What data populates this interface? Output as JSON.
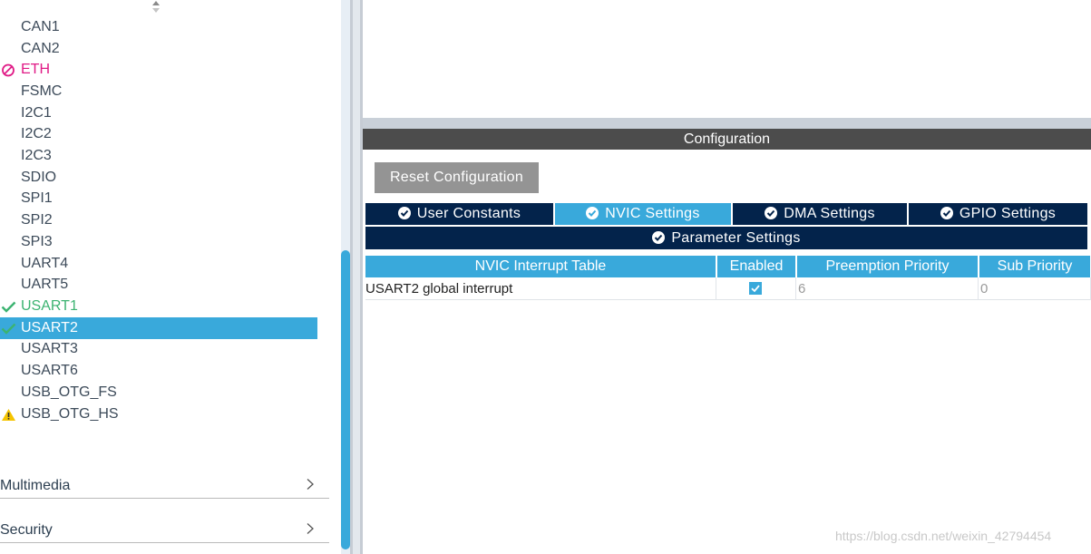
{
  "peripherals": [
    {
      "label": "CAN1",
      "status": "none"
    },
    {
      "label": "CAN2",
      "status": "none"
    },
    {
      "label": "ETH",
      "status": "disabled"
    },
    {
      "label": "FSMC",
      "status": "none"
    },
    {
      "label": "I2C1",
      "status": "none"
    },
    {
      "label": "I2C2",
      "status": "none"
    },
    {
      "label": "I2C3",
      "status": "none"
    },
    {
      "label": "SDIO",
      "status": "none"
    },
    {
      "label": "SPI1",
      "status": "none"
    },
    {
      "label": "SPI2",
      "status": "none"
    },
    {
      "label": "SPI3",
      "status": "none"
    },
    {
      "label": "UART4",
      "status": "none"
    },
    {
      "label": "UART5",
      "status": "none"
    },
    {
      "label": "USART1",
      "status": "ok"
    },
    {
      "label": "USART2",
      "status": "ok",
      "selected": true
    },
    {
      "label": "USART3",
      "status": "none"
    },
    {
      "label": "USART6",
      "status": "none"
    },
    {
      "label": "USB_OTG_FS",
      "status": "none"
    },
    {
      "label": "USB_OTG_HS",
      "status": "warning"
    }
  ],
  "categories": [
    {
      "label": "Multimedia"
    },
    {
      "label": "Security"
    }
  ],
  "configuration": {
    "header": "Configuration",
    "reset_button": "Reset Configuration",
    "tabs": [
      {
        "label": "User Constants",
        "active": false
      },
      {
        "label": "NVIC Settings",
        "active": true
      },
      {
        "label": "DMA Settings",
        "active": false
      },
      {
        "label": "GPIO Settings",
        "active": false
      },
      {
        "label": "Parameter Settings",
        "active": false
      }
    ],
    "table": {
      "columns": [
        "NVIC Interrupt Table",
        "Enabled",
        "Preemption Priority",
        "Sub Priority"
      ],
      "rows": [
        {
          "name": "USART2 global interrupt",
          "enabled": true,
          "preemption": "6",
          "sub": "0"
        }
      ]
    }
  },
  "watermark": "https://blog.csdn.net/weixin_42794454",
  "colors": {
    "accent": "#39a9db",
    "tab_dark": "#03234b",
    "ok_green": "#3cb371",
    "error_pink": "#e01a86",
    "warning_yellow": "#f5c400"
  }
}
